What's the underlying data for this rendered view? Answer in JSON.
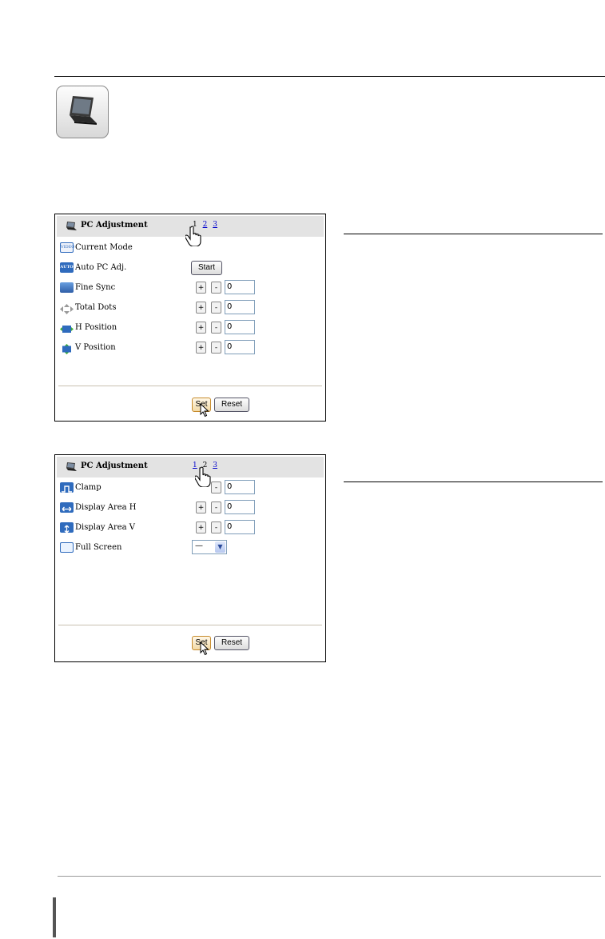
{
  "panel1": {
    "title": "PC Adjustment",
    "pages": [
      "1",
      "2",
      "3"
    ],
    "current_page": "1",
    "rows": [
      {
        "icon_text": "VIDEO",
        "label": "Current Mode"
      },
      {
        "icon_text": "AUTO",
        "label": "Auto PC Adj.",
        "button": "Start"
      },
      {
        "label": "Fine Sync",
        "plus": "+",
        "minus": "-",
        "value": "0"
      },
      {
        "label": "Total Dots",
        "plus": "+",
        "minus": "-",
        "value": "0"
      },
      {
        "label": "H Position",
        "plus": "+",
        "minus": "-",
        "value": "0"
      },
      {
        "label": "V Position",
        "plus": "+",
        "minus": "-",
        "value": "0"
      }
    ],
    "set_label": "Set",
    "reset_label": "Reset"
  },
  "panel2": {
    "title": "PC Adjustment",
    "pages": [
      "1",
      "2",
      "3"
    ],
    "current_page": "2",
    "rows": [
      {
        "label": "Clamp",
        "plus": "+",
        "minus": "-",
        "value": "0"
      },
      {
        "label": "Display Area H",
        "plus": "+",
        "minus": "-",
        "value": "0"
      },
      {
        "label": "Display Area V",
        "plus": "+",
        "minus": "-",
        "value": "0"
      },
      {
        "label": "Full Screen",
        "select_value": "—"
      }
    ],
    "set_label": "Set",
    "reset_label": "Reset"
  },
  "icons": {
    "laptop": "laptop-icon",
    "pointer": "hand-pointer-icon",
    "arrow": "arrow-cursor-icon"
  },
  "colors": {
    "header_bg": "#e3e3e3",
    "link": "#0000cc",
    "set_button": "#f2d9a6",
    "icon_blue": "#2f6bbd"
  }
}
